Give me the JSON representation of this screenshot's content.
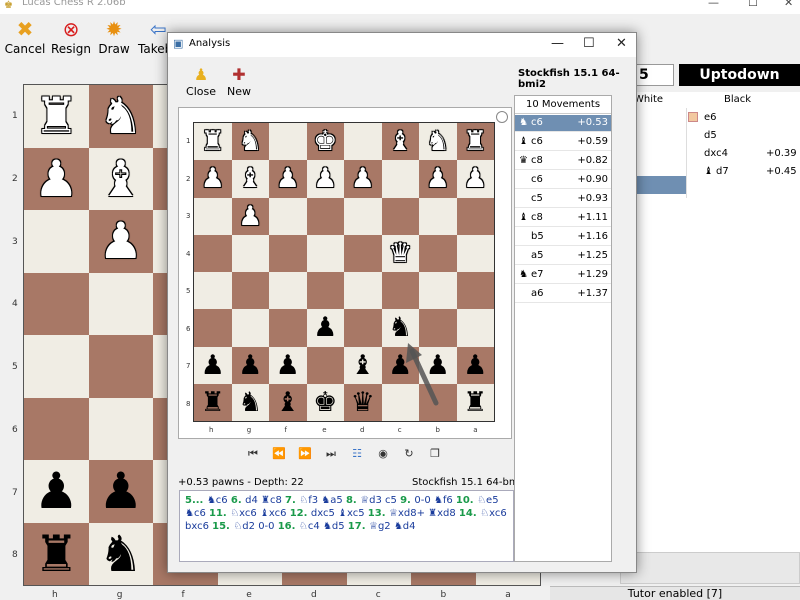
{
  "app": {
    "title": "Lucas Chess R 2.06b",
    "window_controls": {
      "minimize": "—",
      "maximize": "☐",
      "close": "✕"
    }
  },
  "toolbar": {
    "buttons": [
      {
        "label": "Cancel",
        "icon": "cancel-icon"
      },
      {
        "label": "Resign",
        "icon": "resign-icon"
      },
      {
        "label": "Draw",
        "icon": "draw-icon"
      },
      {
        "label": "Takeback",
        "icon": "takeback-icon"
      }
    ]
  },
  "players": {
    "white": "5",
    "black": "Uptodown"
  },
  "moves_table": {
    "headers": {
      "white": "White",
      "black": "Black"
    },
    "rows": [
      {
        "white": "",
        "black": "e6",
        "score": ""
      },
      {
        "white": "",
        "black": "d5",
        "score": ""
      },
      {
        "white": "",
        "black": "dxc4",
        "score": "+0.39"
      },
      {
        "white": "",
        "black": "d7",
        "score": "+0.45",
        "piece": "♝"
      }
    ]
  },
  "tutor": {
    "status": "Tutor enabled [7]"
  },
  "main_board": {
    "ranks": [
      "1",
      "2",
      "3",
      "4",
      "5",
      "6",
      "7",
      "8"
    ],
    "files": [
      "h",
      "g",
      "f",
      "e",
      "d",
      "c",
      "b",
      "a"
    ],
    "pieces": [
      {
        "sq": "11",
        "glyph": "♜",
        "color": "w"
      },
      {
        "sq": "12",
        "glyph": "♞",
        "color": "w"
      },
      {
        "sq": "21",
        "glyph": "♟",
        "color": "w"
      },
      {
        "sq": "22",
        "glyph": "♝",
        "color": "w"
      },
      {
        "sq": "32",
        "glyph": "♟",
        "color": "w"
      },
      {
        "sq": "71",
        "glyph": "♟",
        "color": "b"
      },
      {
        "sq": "72",
        "glyph": "♟",
        "color": "b"
      },
      {
        "sq": "81",
        "glyph": "♜",
        "color": "b"
      },
      {
        "sq": "82",
        "glyph": "♞",
        "color": "b"
      }
    ]
  },
  "analysis": {
    "title": "Analysis",
    "engine": "Stockfish 15.1 64-bmi2",
    "toolbar": {
      "close": "Close",
      "new": "New"
    },
    "ranks": [
      "1",
      "2",
      "3",
      "4",
      "5",
      "6",
      "7",
      "8"
    ],
    "files": [
      "h",
      "g",
      "f",
      "e",
      "d",
      "c",
      "b",
      "a"
    ],
    "board": [
      [
        "♜w",
        "♞w",
        "",
        "♚w",
        "",
        "♝w",
        "♞w",
        "♜w"
      ],
      [
        "♟w",
        "♝w",
        "♟w",
        "♟w",
        "♟w",
        "",
        "♟w",
        "♟w"
      ],
      [
        "",
        "♟w",
        "",
        "",
        "",
        "",
        "",
        ""
      ],
      [
        "",
        "",
        "",
        "",
        "",
        "♛w",
        "",
        ""
      ],
      [
        "",
        "",
        "",
        "",
        "",
        "",
        "",
        ""
      ],
      [
        "",
        "",
        "",
        "♟b",
        "",
        "♞b",
        "",
        ""
      ],
      [
        "♟b",
        "♟b",
        "♟b",
        "",
        "♝b",
        "♟b",
        "♟b",
        "♟b"
      ],
      [
        "♜b",
        "♞b",
        "♝b",
        "♚b",
        "♛b",
        "",
        "",
        "♜b"
      ]
    ],
    "eval": "+0.53 pawns   -   Depth: 22",
    "pv": [
      {
        "t": "5... ",
        "c": "num"
      },
      {
        "t": "♞c6 ",
        "c": ""
      },
      {
        "t": "6. ",
        "c": "num"
      },
      {
        "t": "d4 ♜c8 ",
        "c": ""
      },
      {
        "t": "7. ",
        "c": "num"
      },
      {
        "t": "♘f3 ♞a5 ",
        "c": ""
      },
      {
        "t": "8. ",
        "c": "num"
      },
      {
        "t": "♕d3 c5 ",
        "c": ""
      },
      {
        "t": "9. ",
        "c": "num"
      },
      {
        "t": "0-0 ♞f6 ",
        "c": ""
      },
      {
        "t": "10. ",
        "c": "num"
      },
      {
        "t": "♘e5 ♞c6 ",
        "c": ""
      },
      {
        "t": "11. ",
        "c": "num"
      },
      {
        "t": "♘xc6 ♝xc6 ",
        "c": ""
      },
      {
        "t": "12. ",
        "c": "num"
      },
      {
        "t": "dxc5 ♝xc5 ",
        "c": ""
      },
      {
        "t": "13. ",
        "c": "num"
      },
      {
        "t": "♕xd8+ ♜xd8 ",
        "c": ""
      },
      {
        "t": "14. ",
        "c": "num"
      },
      {
        "t": "♘xc6 bxc6 ",
        "c": ""
      },
      {
        "t": "15. ",
        "c": "num"
      },
      {
        "t": "♘d2 0-0 ",
        "c": ""
      },
      {
        "t": "16. ",
        "c": "num"
      },
      {
        "t": "♘c4 ♞d5 ",
        "c": ""
      },
      {
        "t": "17. ",
        "c": "num"
      },
      {
        "t": "♕g2 ♞d4",
        "c": ""
      }
    ],
    "list_header": "10 Movements",
    "list": [
      {
        "piece": "♞",
        "move": "c6",
        "score": "+0.53",
        "selected": true
      },
      {
        "piece": "♝",
        "move": "c6",
        "score": "+0.59"
      },
      {
        "piece": "♛",
        "move": "c8",
        "score": "+0.82"
      },
      {
        "piece": "",
        "move": "c6",
        "score": "+0.90"
      },
      {
        "piece": "",
        "move": "c5",
        "score": "+0.93"
      },
      {
        "piece": "♝",
        "move": "c8",
        "score": "+1.11"
      },
      {
        "piece": "",
        "move": "b5",
        "score": "+1.16"
      },
      {
        "piece": "",
        "move": "a5",
        "score": "+1.25"
      },
      {
        "piece": "♞",
        "move": "e7",
        "score": "+1.29"
      },
      {
        "piece": "",
        "move": "a6",
        "score": "+1.37"
      }
    ]
  }
}
